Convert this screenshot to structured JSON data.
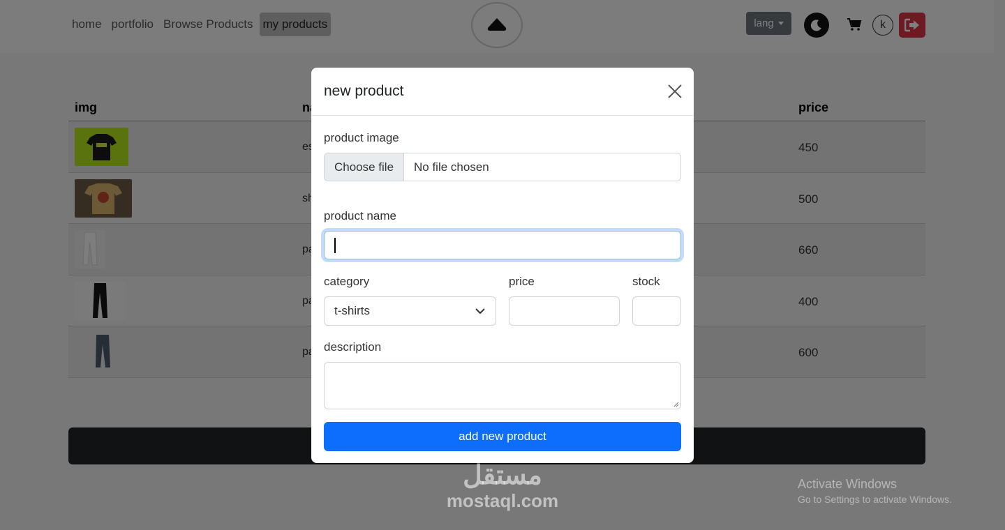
{
  "nav": {
    "links": [
      "home",
      "portfolio",
      "Browse Products",
      "my products"
    ],
    "lang_label": "lang",
    "avatar_letter": "k"
  },
  "table": {
    "headers": {
      "img": "img",
      "name": "na",
      "price": "price"
    },
    "rows": [
      {
        "name": "es",
        "price": "450"
      },
      {
        "name": "sh",
        "price": "500"
      },
      {
        "name": "pa",
        "price": "660"
      },
      {
        "name": "pa",
        "price": "400"
      },
      {
        "name": "pa",
        "price": "600"
      }
    ]
  },
  "modal": {
    "title": "new product",
    "image_label": "product image",
    "file_button": "Choose file",
    "file_status": "No file chosen",
    "name_label": "product name",
    "name_value": "",
    "category_label": "category",
    "category_value": "t-shirts",
    "price_label": "price",
    "stock_label": "stock",
    "description_label": "description",
    "submit_label": "add new product"
  },
  "watermark": {
    "arabic": "مستقل",
    "latin": "mostaql.com"
  },
  "activation": {
    "title": "Activate Windows",
    "subtitle": "Go to Settings to activate Windows."
  },
  "colors": {
    "primary": "#0d6efd",
    "danger": "#dc3545",
    "secondary": "#6c757d"
  }
}
